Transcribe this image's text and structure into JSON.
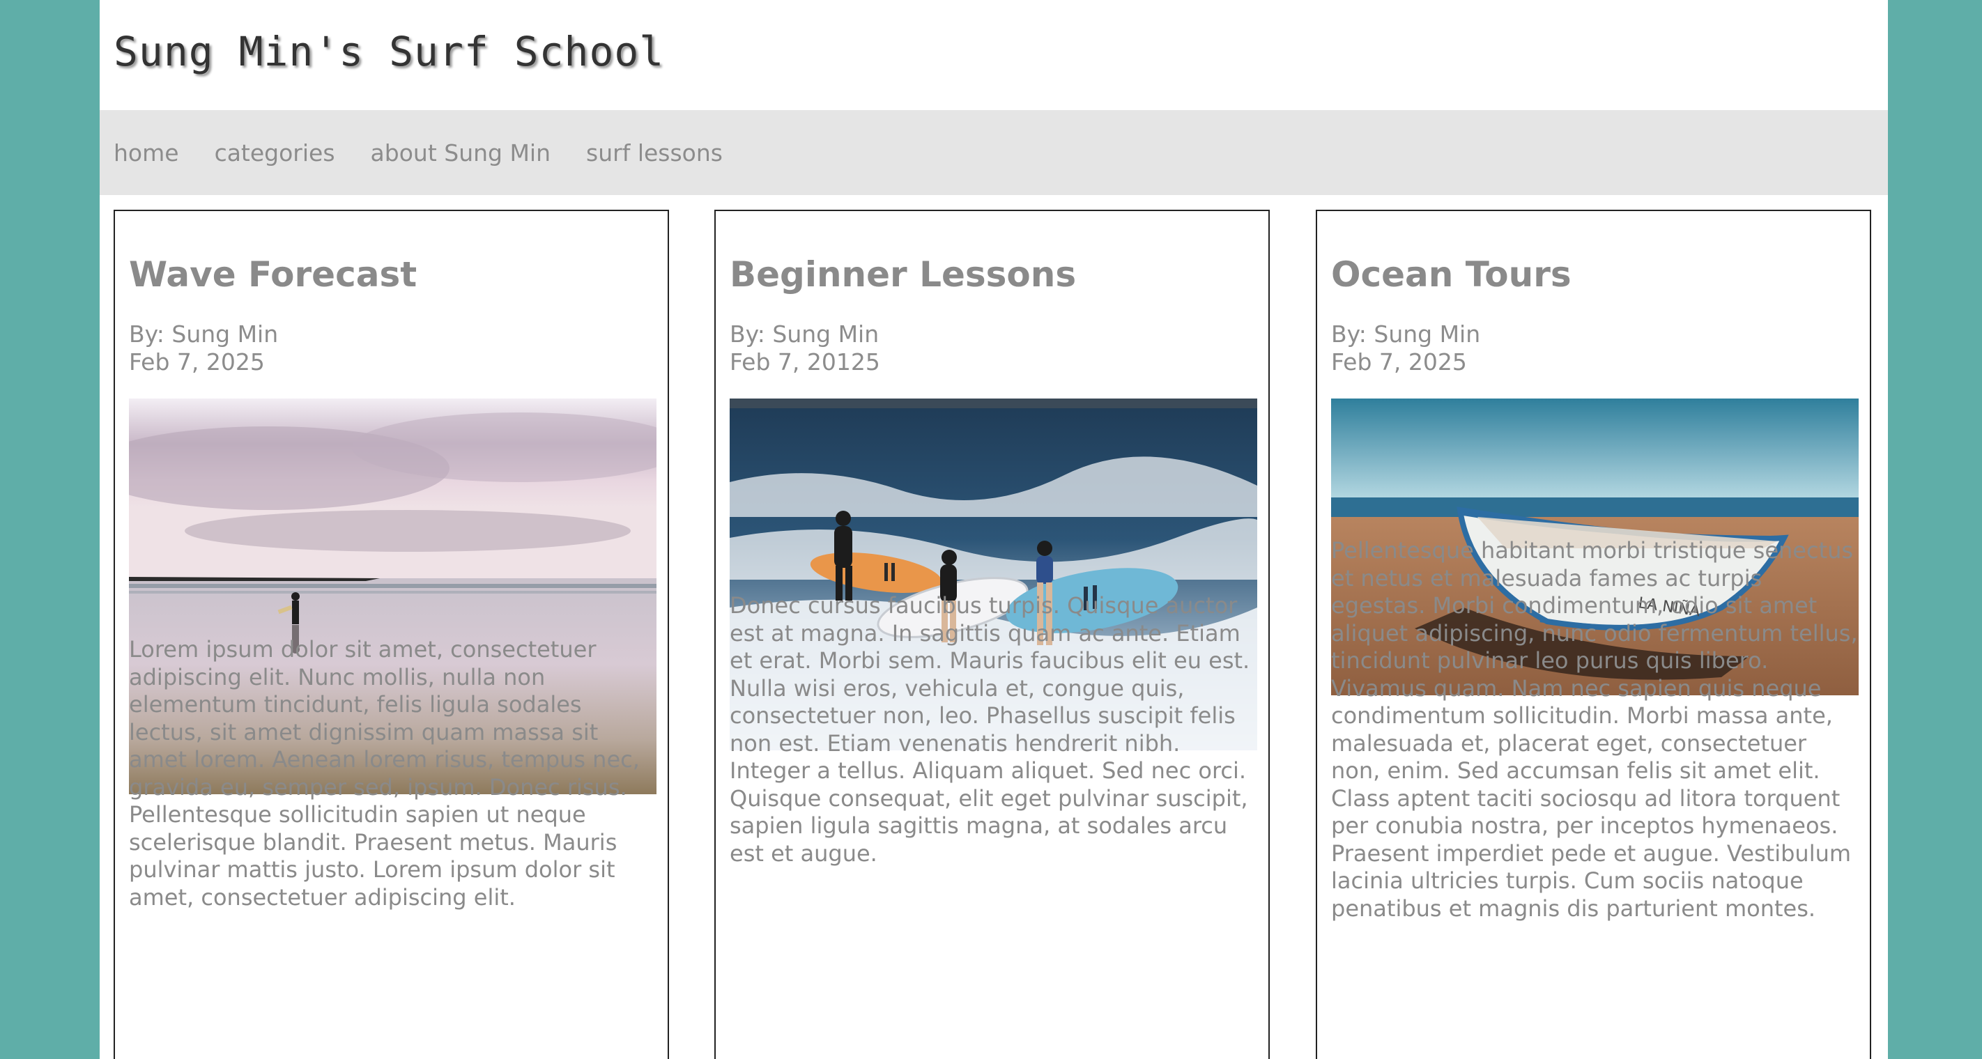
{
  "site": {
    "title": "Sung Min's Surf School"
  },
  "nav": {
    "items": [
      "home",
      "categories",
      "about Sung Min",
      "surf lessons"
    ]
  },
  "posts": [
    {
      "title": "Wave Forecast",
      "author": "By: Sung Min",
      "date": "Feb 7, 2025",
      "image": "surfer-on-beach-at-dusk",
      "body": "Lorem ipsum dolor sit amet, consectetuer adipiscing elit. Nunc mollis, nulla non elementum tincidunt, felis ligula sodales lectus, sit amet dignissim quam massa sit amet lorem. Aenean lorem risus, tempus nec, gravida eu, semper sed, ipsum. Donec risus. Pellentesque sollicitudin sapien ut neque scelerisque blandit. Praesent metus. Mauris pulvinar mattis justo. Lorem ipsum dolor sit amet, consectetuer adipiscing elit."
    },
    {
      "title": "Beginner Lessons",
      "author": "By: Sung Min",
      "date": "Feb 7, 20125",
      "image": "surfers-carrying-boards-into-waves",
      "body": "Donec cursus faucibus turpis. Quisque auctor est at magna. In sagittis quam ac ante. Etiam et erat. Morbi sem. Mauris faucibus elit eu est. Nulla wisi eros, vehicula et, congue quis, consectetuer non, leo. Phasellus suscipit felis non est. Etiam venenatis hendrerit nibh. Integer a tellus. Aliquam aliquet. Sed nec orci. Quisque consequat, elit eget pulvinar suscipit, sapien ligula sagittis magna, at sodales arcu est et augue."
    },
    {
      "title": "Ocean Tours",
      "author": "By: Sung Min",
      "date": "Feb 7, 2025",
      "image": "boat-on-sandy-beach",
      "body": "Pellentesque habitant morbi tristique senectus et netus et malesuada fames ac turpis egestas. Morbi condimentum, odio sit amet aliquet adipiscing, nunc odio fermentum tellus, tincidunt pulvinar leo purus quis libero. Vivamus quam. Nam nec sapien quis neque condimentum sollicitudin. Morbi massa ante, malesuada et, placerat eget, consectetuer non, enim. Sed accumsan felis sit amet elit. Class aptent taciti sociosqu ad litora torquent per conubia nostra, per inceptos hymenaeos. Praesent imperdiet pede et augue. Vestibulum lacinia ultricies turpis. Cum sociis natoque penatibus et magnis dis parturient montes."
    }
  ],
  "colors": {
    "page_background": "#5faea8",
    "nav_background": "#e5e5e5",
    "text_gray": "#8a8a8a"
  }
}
